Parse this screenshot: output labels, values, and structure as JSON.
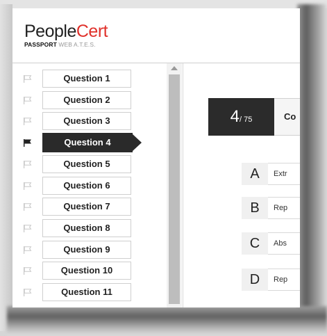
{
  "header": {
    "logo_primary": "People",
    "logo_accent": "Cert",
    "logo_sub_bold": "PASSPORT",
    "logo_sub_light": "WEB A.T.E.S."
  },
  "sidebar": {
    "questions": [
      {
        "label": "Question 1",
        "flagged": false,
        "active": false
      },
      {
        "label": "Question 2",
        "flagged": false,
        "active": false
      },
      {
        "label": "Question 3",
        "flagged": false,
        "active": false
      },
      {
        "label": "Question 4",
        "flagged": true,
        "active": true
      },
      {
        "label": "Question 5",
        "flagged": false,
        "active": false
      },
      {
        "label": "Question 6",
        "flagged": false,
        "active": false
      },
      {
        "label": "Question 7",
        "flagged": false,
        "active": false
      },
      {
        "label": "Question 8",
        "flagged": false,
        "active": false
      },
      {
        "label": "Question 9",
        "flagged": false,
        "active": false
      },
      {
        "label": "Question 10",
        "flagged": false,
        "active": false
      },
      {
        "label": "Question 11",
        "flagged": false,
        "active": false
      }
    ]
  },
  "main": {
    "question_number": "4",
    "question_total": "/ 75",
    "question_label": "Co",
    "options": [
      {
        "letter": "A",
        "text": "Extr"
      },
      {
        "letter": "B",
        "text": "Rep"
      },
      {
        "letter": "C",
        "text": "Abs"
      },
      {
        "letter": "D",
        "text": "Rep"
      }
    ]
  },
  "colors": {
    "accent": "#e0312b",
    "active_question": "#2a2a2a"
  }
}
